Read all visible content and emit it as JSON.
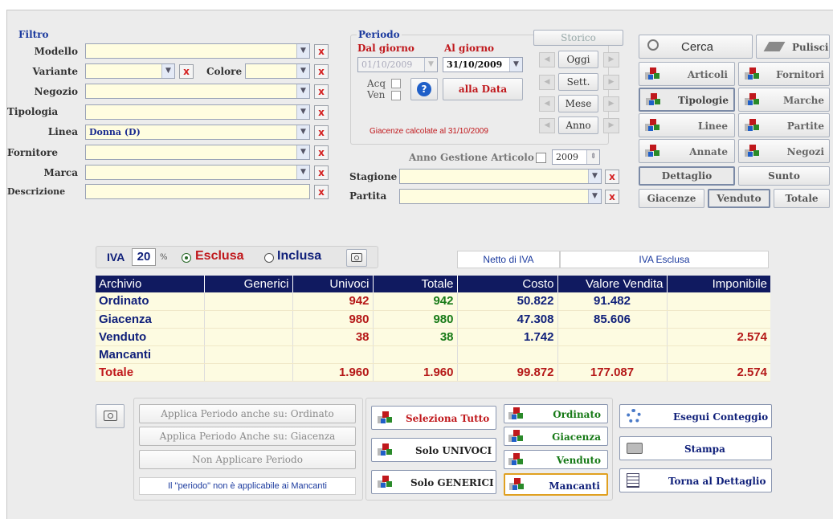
{
  "filtro": {
    "title": "Filtro",
    "modello": {
      "label": "Modello",
      "value": ""
    },
    "variante": {
      "label": "Variante",
      "value": ""
    },
    "colore": {
      "label": "Colore",
      "value": ""
    },
    "negozio": {
      "label": "Negozio",
      "value": ""
    },
    "tipologia": {
      "label": "Tipologia",
      "value": ""
    },
    "linea": {
      "label": "Linea",
      "value": "Donna  (D)"
    },
    "fornitore": {
      "label": "Fornitore",
      "value": ""
    },
    "marca": {
      "label": "Marca",
      "value": ""
    },
    "descrizione": {
      "label": "Descrizione",
      "value": ""
    },
    "clear_glyph": "x"
  },
  "periodo": {
    "title": "Periodo",
    "dal_label": "Dal giorno",
    "al_label": "Al giorno",
    "dal_value": "01/10/2009",
    "al_value": "31/10/2009",
    "acq_label": "Acq",
    "ven_label": "Ven",
    "alla_data": "alla Data",
    "giacenze_note": "Giacenze calcolate al 31/10/2009",
    "storico": "Storico",
    "oggi": "Oggi",
    "sett": "Sett.",
    "mese": "Mese",
    "anno": "Anno",
    "anno_gestione_label": "Anno Gestione Articolo",
    "anno_gestione_value": "2009",
    "stagione_label": "Stagione",
    "partita_label": "Partita"
  },
  "actions": {
    "cerca": "Cerca",
    "pulisci": "Pulisci",
    "articoli": "Articoli",
    "fornitori": "Fornitori",
    "tipologie": "Tipologie",
    "marche": "Marche",
    "linee": "Linee",
    "partite": "Partite",
    "annate": "Annate",
    "negozi": "Negozi",
    "dettaglio": "Dettaglio",
    "sunto": "Sunto",
    "giacenze": "Giacenze",
    "venduto": "Venduto",
    "totale": "Totale"
  },
  "iva": {
    "label": "IVA",
    "value": "20",
    "percent": "%",
    "esclusa": "Esclusa",
    "inclusa": "Inclusa",
    "netto_label": "Netto di IVA",
    "mode_label": "IVA Esclusa"
  },
  "table": {
    "headers": [
      "Archivio",
      "Generici",
      "Univoci",
      "Totale",
      "Costo",
      "Valore Vendita",
      "Imponibile"
    ],
    "rows": [
      {
        "name": "Ordinato",
        "generici": "",
        "univoci": "942",
        "totale": "942",
        "costo": "50.822",
        "valore": "91.482",
        "imponibile": ""
      },
      {
        "name": "Giacenza",
        "generici": "",
        "univoci": "980",
        "totale": "980",
        "costo": "47.308",
        "valore": "85.606",
        "imponibile": ""
      },
      {
        "name": "Venduto",
        "generici": "",
        "univoci": "38",
        "totale": "38",
        "costo": "1.742",
        "valore": "",
        "imponibile": "2.574"
      },
      {
        "name": "Mancanti",
        "generici": "",
        "univoci": "",
        "totale": "",
        "costo": "",
        "valore": "",
        "imponibile": ""
      },
      {
        "name": "Totale",
        "generici": "",
        "univoci": "1.960",
        "totale": "1.960",
        "costo": "99.872",
        "valore": "177.087",
        "imponibile": "2.574"
      }
    ]
  },
  "bottom": {
    "applica_ordinato": "Applica Periodo anche su: Ordinato",
    "applica_giacenza": "Applica Periodo Anche su: Giacenza",
    "non_applicare": "Non Applicare Periodo",
    "periodo_note": "Il \"periodo\" non è applicabile ai Mancanti",
    "seleziona_tutto": "Seleziona Tutto",
    "solo_univoci": "Solo UNIVOCI",
    "solo_generici": "Solo GENERICI",
    "ordinato": "Ordinato",
    "giacenza": "Giacenza",
    "venduto": "Venduto",
    "mancanti": "Mancanti",
    "esegui": "Esegui Conteggio",
    "stampa": "Stampa",
    "torna": "Torna al Dettaglio"
  },
  "colors": {
    "header_navy": "#101a60",
    "row_bg": "#fdfbe1",
    "red": "#b51818",
    "green": "#177a17"
  }
}
